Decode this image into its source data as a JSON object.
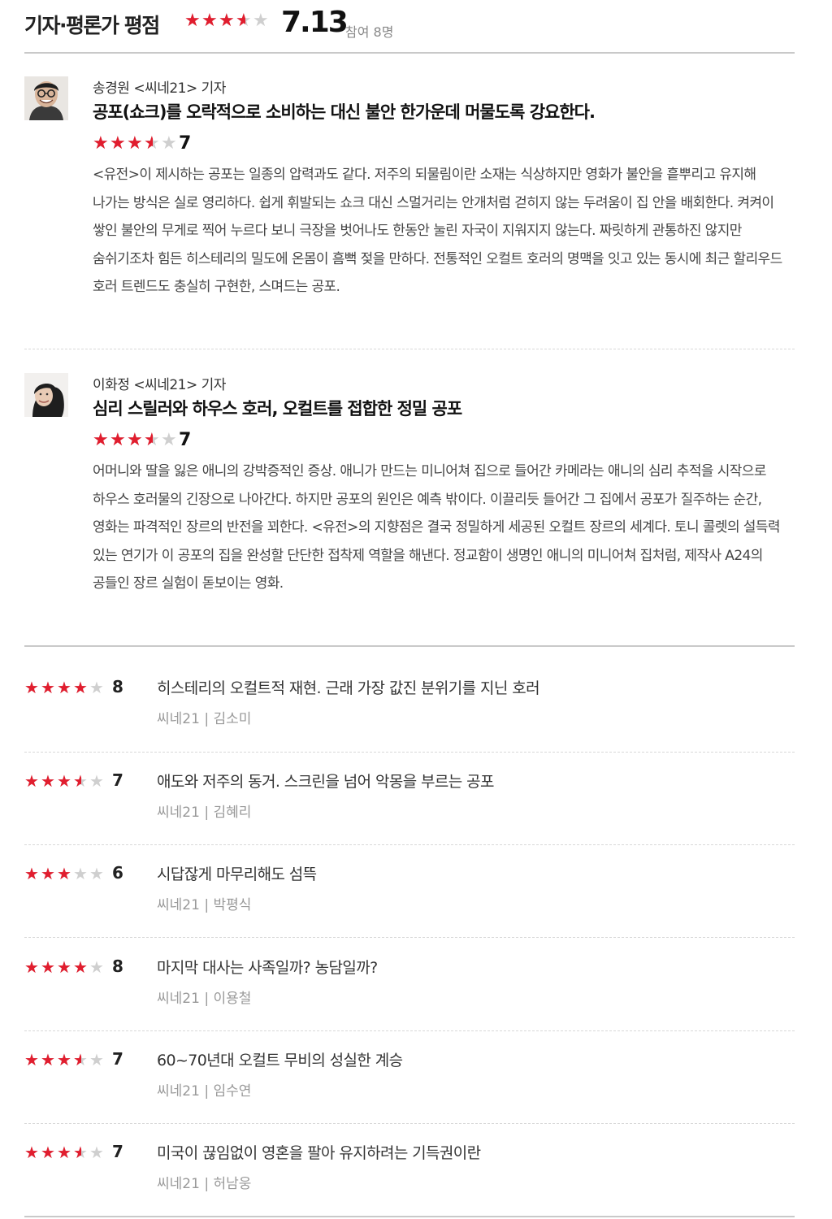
{
  "header": {
    "title": "기자·평론가 평점",
    "score": "7.13",
    "participants": "참여 8명",
    "rating_fraction": 0.713
  },
  "colors": {
    "star_filled": "#e11d2e",
    "star_empty": "#cfcfcf",
    "divider": "#c9c9c9"
  },
  "reviews": [
    {
      "author": "송경원 <씨네21> 기자",
      "headline": "공포(쇼크)를 오락적으로 소비하는 대신 불안 한가운데 머물도록 강요한다.",
      "score": "7",
      "rating": 7,
      "avatar_icon": "reviewer-photo-icon",
      "body": "<유전>이 제시하는 공포는 일종의 압력과도 같다. 저주의 되물림이란 소재는 식상하지만 영화가 불안을 흩뿌리고 유지해 나가는 방식은 실로 영리하다. 쉽게 휘발되는 쇼크 대신 스멀거리는 안개처럼 걷히지 않는 두려움이 집 안을 배회한다. 켜켜이 쌓인 불안의 무게로 찍어 누르다 보니 극장을 벗어나도 한동안 눌린 자국이 지워지지 않는다. 짜릿하게 관통하진 않지만 숨쉬기조차 힘든 히스테리의 밀도에 온몸이 흠뻑 젖을 만하다. 전통적인 오컬트 호러의 명맥을 잇고 있는 동시에 최근 할리우드 호러 트렌드도 충실히 구현한, 스며드는 공포."
    },
    {
      "author": "이화정 <씨네21> 기자",
      "headline": "심리 스릴러와 하우스 호러, 오컬트를 접합한 정밀 공포",
      "score": "7",
      "rating": 7,
      "avatar_icon": "reviewer-photo-icon",
      "body": "어머니와 딸을 잃은 애니의 강박증적인 증상. 애니가 만드는 미니어쳐 집으로 들어간 카메라는 애니의 심리 추적을 시작으로 하우스 호러물의 긴장으로 나아간다. 하지만 공포의 원인은 예측 밖이다. 이끌리듯 들어간 그 집에서 공포가 질주하는 순간, 영화는 파격적인 장르의 반전을 꾀한다. <유전>의 지향점은 결국 정밀하게 세공된 오컬트 장르의 세계다. 토니 콜렛의 설득력 있는 연기가 이 공포의 집을 완성할 단단한 접착제 역할을 해낸다. 정교함이 생명인 애니의 미니어쳐 집처럼, 제작사 A24의 공들인 장르 실험이 돋보이는 영화."
    }
  ],
  "short_reviews": [
    {
      "score": "8",
      "rating": 8,
      "text": "히스테리의 오컬트적 재현. 근래 가장 값진 분위기를 지닌 호러",
      "author": "씨네21 | 김소미"
    },
    {
      "score": "7",
      "rating": 7,
      "text": "애도와 저주의 동거. 스크린을 넘어 악몽을 부르는 공포",
      "author": "씨네21 | 김혜리"
    },
    {
      "score": "6",
      "rating": 6,
      "text": "시답잖게 마무리해도 섬뜩",
      "author": "씨네21 | 박평식"
    },
    {
      "score": "8",
      "rating": 8,
      "text": "마지막 대사는 사족일까? 농담일까?",
      "author": "씨네21 | 이용철"
    },
    {
      "score": "7",
      "rating": 7,
      "text": "60~70년대 오컬트 무비의 성실한 계승",
      "author": "씨네21 | 임수연"
    },
    {
      "score": "7",
      "rating": 7,
      "text": "미국이 끊임없이 영혼을 팔아 유지하려는 기득권이란",
      "author": "씨네21 | 허남웅"
    }
  ]
}
